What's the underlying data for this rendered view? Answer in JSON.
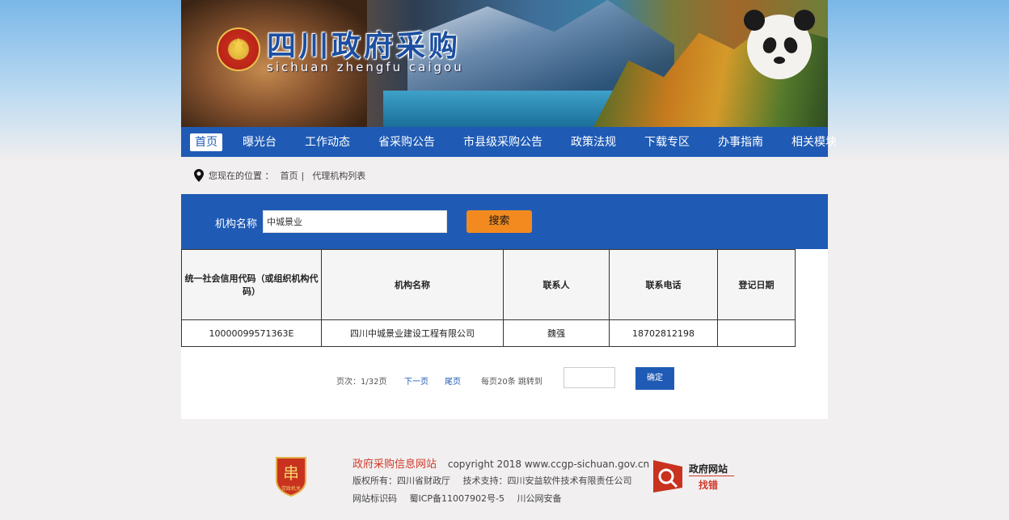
{
  "banner": {
    "title_cn": "四川政府采购",
    "title_py": "sichuan zhengfu caigou"
  },
  "nav": {
    "items": [
      "首页",
      "曝光台",
      "工作动态",
      "省采购公告",
      "市县级采购公告",
      "政策法规",
      "下载专区",
      "办事指南",
      "相关模块"
    ],
    "active_index": 0
  },
  "breadcrumb": {
    "prefix": "您现在的位置 ：",
    "home": "首页",
    "separator": "|",
    "current": "代理机构列表"
  },
  "search": {
    "label": "机构名称",
    "value": "中城景业",
    "button": "搜索"
  },
  "table": {
    "headers": [
      "统一社会信用代码（或组织机构代码）",
      "机构名称",
      "联系人",
      "联系电话",
      "登记日期"
    ],
    "rows": [
      [
        "10000099571363E",
        "四川中城景业建设工程有限公司",
        "魏强",
        "18702812198",
        ""
      ]
    ]
  },
  "pager": {
    "page_info": "页次：1/32页",
    "next": "下一页",
    "last": "尾页",
    "per_page": "每页20条 跳转到",
    "jump_value": "",
    "confirm": "确定"
  },
  "footer": {
    "site_name": "政府采购信息网站",
    "copyright": "copyright 2018 www.ccgp-sichuan.gov.cn",
    "owner": "版权所有：四川省财政厅",
    "support": "技术支持：四川安益软件技术有限责任公司",
    "site_code": "网站标识码",
    "icp": "蜀ICP备11007902号-5",
    "police": "川公网安备",
    "badge_text": "党政机关",
    "error_title": "政府网站",
    "error_sub": "找错"
  },
  "colors": {
    "brand_blue": "#1f5bb5",
    "search_orange": "#f28a1f",
    "footer_red": "#d13a2b"
  }
}
